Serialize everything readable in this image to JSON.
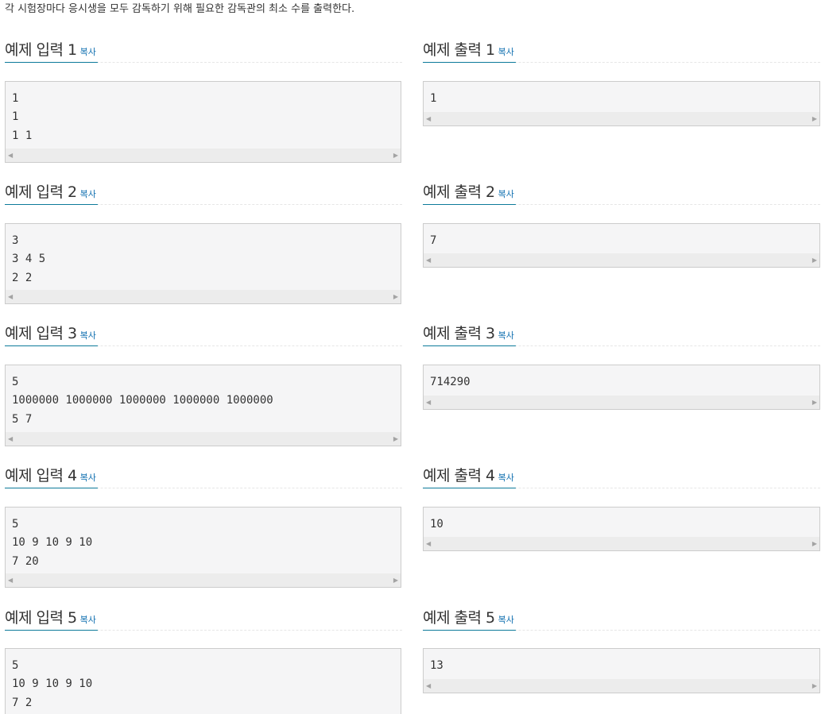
{
  "intro": "각 시험장마다 응시생을 모두 감독하기 위해 필요한 감독관의 최소 수를 출력한다.",
  "copy_label": "복사",
  "examples": [
    {
      "input_title": "예제 입력 1",
      "input": "1\n1\n1 1",
      "output_title": "예제 출력 1",
      "output": "1"
    },
    {
      "input_title": "예제 입력 2",
      "input": "3\n3 4 5\n2 2",
      "output_title": "예제 출력 2",
      "output": "7"
    },
    {
      "input_title": "예제 입력 3",
      "input": "5\n1000000 1000000 1000000 1000000 1000000\n5 7",
      "output_title": "예제 출력 3",
      "output": "714290"
    },
    {
      "input_title": "예제 입력 4",
      "input": "5\n10 9 10 9 10\n7 20",
      "output_title": "예제 출력 4",
      "output": "10"
    },
    {
      "input_title": "예제 입력 5",
      "input": "5\n10 9 10 9 10\n7 2",
      "output_title": "예제 출력 5",
      "output": "13"
    }
  ]
}
